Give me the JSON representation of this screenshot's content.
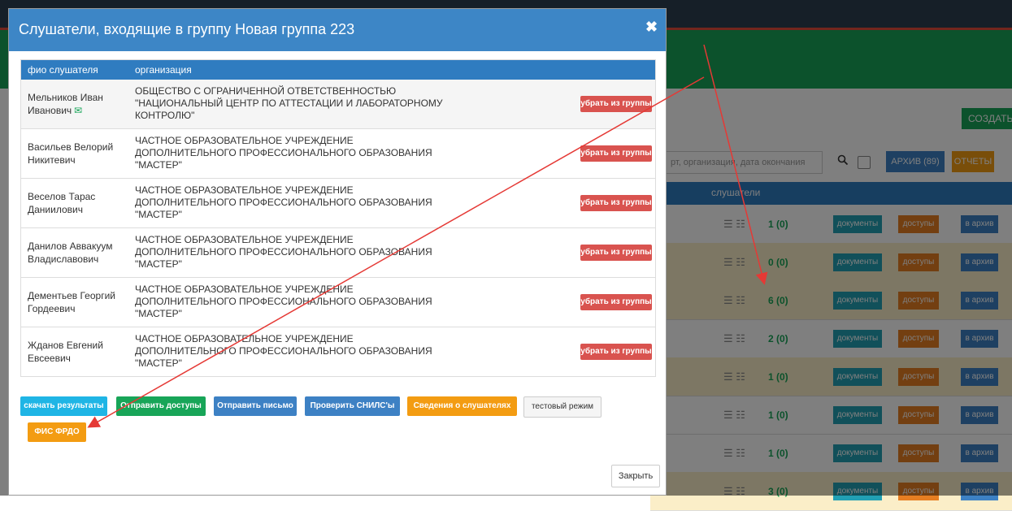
{
  "background": {
    "create_label": "СОЗДАТЬ",
    "search_placeholder": "рт, организация, дата окончания",
    "archive_label": "АРХИВ (89)",
    "reports_label": "ОТЧЕТЫ",
    "listeners_header": "слушатели",
    "rows": [
      {
        "count": "1 (0)",
        "docs": "документы",
        "access": "доступы",
        "archive": "в архив"
      },
      {
        "count": "0 (0)",
        "docs": "документы",
        "access": "доступы",
        "archive": "в архив"
      },
      {
        "count": "6 (0)",
        "docs": "документы",
        "access": "доступы",
        "archive": "в архив"
      },
      {
        "count": "2 (0)",
        "docs": "документы",
        "access": "доступы",
        "archive": "в архив"
      },
      {
        "count": "1 (0)",
        "docs": "документы",
        "access": "доступы",
        "archive": "в архив"
      },
      {
        "count": "1 (0)",
        "docs": "документы",
        "access": "доступы",
        "archive": "в архив"
      },
      {
        "count": "1 (0)",
        "docs": "документы",
        "access": "доступы",
        "archive": "в архив"
      },
      {
        "count": "3 (0)",
        "docs": "документы",
        "access": "доступы",
        "archive": "в архив"
      }
    ]
  },
  "modal": {
    "title": "Слушатели, входящие в группу Новая группа 223",
    "close_icon": "close-icon",
    "table": {
      "headers": [
        "фио слушателя",
        "организация"
      ],
      "remove_label": "убрать из группы",
      "rows": [
        {
          "name_l1": "Мельников Иван",
          "name_l2": "Иванович",
          "has_mail_icon": true,
          "org_l1": "ОБЩЕСТВО С ОГРАНИЧЕННОЙ ОТВЕТСТВЕННОСТЬЮ",
          "org_l2": "\"НАЦИОНАЛЬНЫЙ ЦЕНТР ПО АТТЕСТАЦИИ И ЛАБОРАТОРНОМУ",
          "org_l3": "КОНТРОЛЮ\""
        },
        {
          "name_l1": "Васильев Велорий",
          "name_l2": "Никитевич",
          "org_l1": "ЧАСТНОЕ ОБРАЗОВАТЕЛЬНОЕ УЧРЕЖДЕНИЕ",
          "org_l2": "ДОПОЛНИТЕЛЬНОГО ПРОФЕССИОНАЛЬНОГО ОБРАЗОВАНИЯ",
          "org_l3": "\"МАСТЕР\""
        },
        {
          "name_l1": "Веселов Тарас",
          "name_l2": "Даниилович",
          "org_l1": "ЧАСТНОЕ ОБРАЗОВАТЕЛЬНОЕ УЧРЕЖДЕНИЕ",
          "org_l2": "ДОПОЛНИТЕЛЬНОГО ПРОФЕССИОНАЛЬНОГО ОБРАЗОВАНИЯ",
          "org_l3": "\"МАСТЕР\""
        },
        {
          "name_l1": "Данилов Аввакуум",
          "name_l2": "Владиславович",
          "org_l1": "ЧАСТНОЕ ОБРАЗОВАТЕЛЬНОЕ УЧРЕЖДЕНИЕ",
          "org_l2": "ДОПОЛНИТЕЛЬНОГО ПРОФЕССИОНАЛЬНОГО ОБРАЗОВАНИЯ",
          "org_l3": "\"МАСТЕР\""
        },
        {
          "name_l1": "Дементьев Георгий",
          "name_l2": "Гордеевич",
          "org_l1": "ЧАСТНОЕ ОБРАЗОВАТЕЛЬНОЕ УЧРЕЖДЕНИЕ",
          "org_l2": "ДОПОЛНИТЕЛЬНОГО ПРОФЕССИОНАЛЬНОГО ОБРАЗОВАНИЯ",
          "org_l3": "\"МАСТЕР\""
        },
        {
          "name_l1": "Жданов Евгений",
          "name_l2": "Евсеевич",
          "org_l1": "ЧАСТНОЕ ОБРАЗОВАТЕЛЬНОЕ УЧРЕЖДЕНИЕ",
          "org_l2": "ДОПОЛНИТЕЛЬНОГО ПРОФЕССИОНАЛЬНОГО ОБРАЗОВАНИЯ",
          "org_l3": "\"МАСТЕР\""
        }
      ]
    },
    "buttons": {
      "download": "скачать результаты",
      "send_access": "Отправить доступы",
      "send_letter": "Отправить письмо",
      "check_snils": "Проверить СНИЛС'ы",
      "listeners_info": "Сведения о слушателях",
      "test_mode": "тестовый режим",
      "fis_frdo": "ФИС ФРДО",
      "close": "Закрыть"
    },
    "colors": {
      "header": "#3d86c6",
      "remove": "#d9534f",
      "download": "#1fb5e5",
      "send_access": "#18a558",
      "send_letter": "#3d81c4",
      "check_snils": "#3d81c4",
      "listeners_info": "#f39c12",
      "fis_frdo": "#f39c12",
      "annotation_arrow": "#e53935"
    }
  }
}
